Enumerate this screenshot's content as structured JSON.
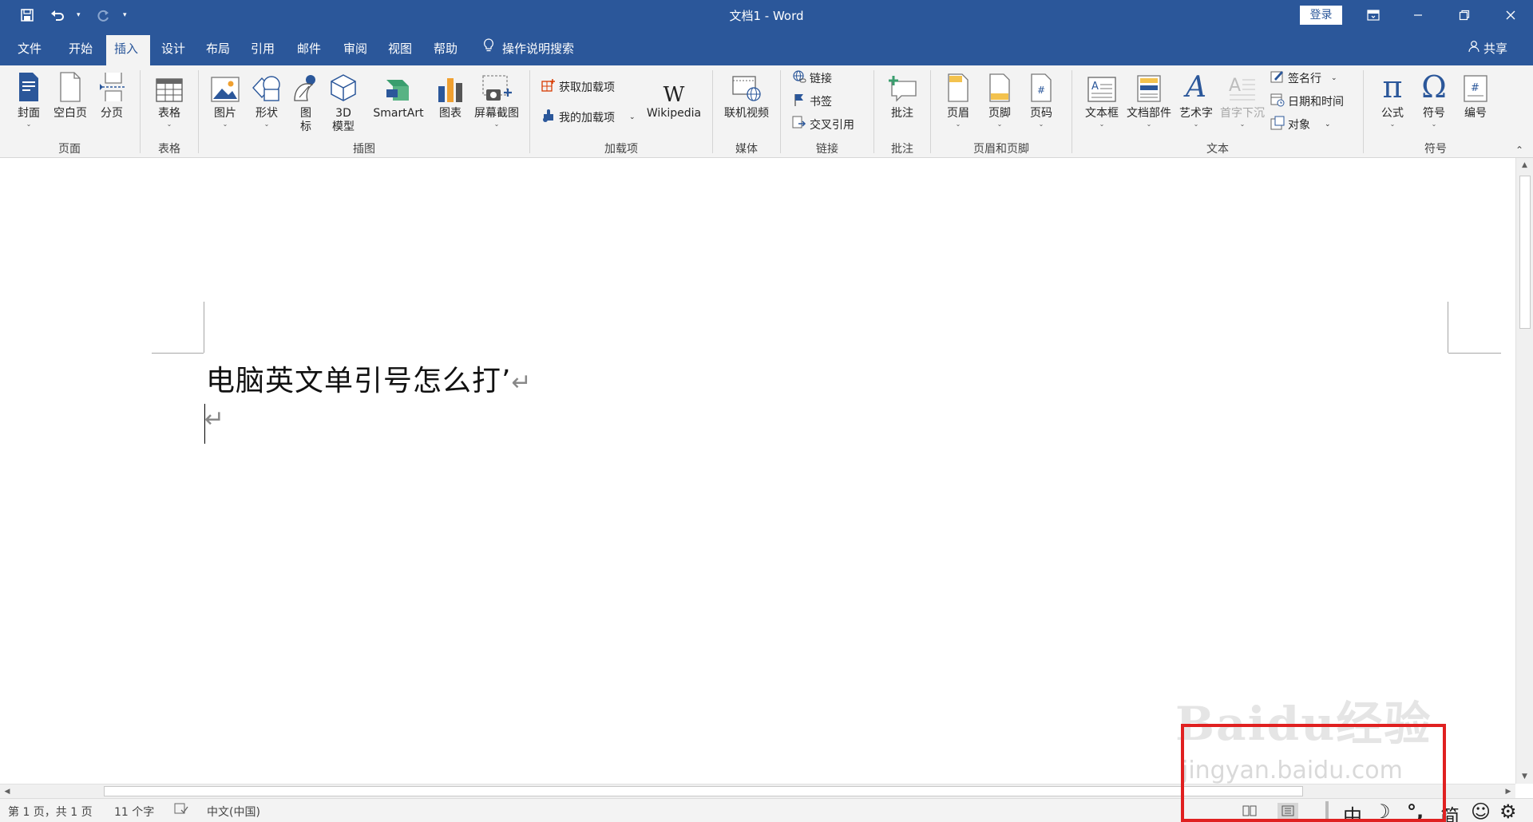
{
  "window": {
    "title": "文档1  -  Word",
    "login_label": "登录"
  },
  "menu": {
    "tabs": [
      "文件",
      "开始",
      "插入",
      "设计",
      "布局",
      "引用",
      "邮件",
      "审阅",
      "视图",
      "帮助"
    ],
    "active_tab": "插入",
    "tell_me": "操作说明搜索",
    "share": "共享"
  },
  "ribbon": {
    "groups": {
      "pages": {
        "label": "页面",
        "buttons": [
          "封面",
          "空白页",
          "分页"
        ]
      },
      "tables": {
        "label": "表格",
        "buttons": [
          "表格"
        ]
      },
      "illustrations": {
        "label": "插图",
        "buttons": [
          "图片",
          "形状",
          "图\n标",
          "3D\n模型",
          "SmartArt",
          "图表",
          "屏幕截图"
        ]
      },
      "addins": {
        "label": "加载项",
        "get": "获取加载项",
        "mine": "我的加载项",
        "wikipedia": "Wikipedia"
      },
      "media": {
        "label": "媒体",
        "buttons": [
          "联机视频"
        ]
      },
      "links": {
        "label": "链接",
        "items": [
          "链接",
          "书签",
          "交叉引用"
        ]
      },
      "comments": {
        "label": "批注",
        "buttons": [
          "批注"
        ]
      },
      "header_footer": {
        "label": "页眉和页脚",
        "buttons": [
          "页眉",
          "页脚",
          "页码"
        ]
      },
      "text": {
        "label": "文本",
        "buttons": [
          "文本框",
          "文档部件",
          "艺术字",
          "首字下沉"
        ],
        "small": [
          "签名行",
          "日期和时间",
          "对象"
        ]
      },
      "symbols": {
        "label": "符号",
        "buttons": [
          "公式",
          "符号",
          "编号"
        ]
      }
    }
  },
  "document": {
    "line1": "电脑英文单引号怎么打’",
    "para_mark": "↵"
  },
  "status": {
    "page": "第 1 页，共 1 页",
    "words": "11 个字",
    "language": "中文(中国)"
  },
  "ime": {
    "mode": "中",
    "punct": "°,",
    "script": "简"
  },
  "watermark": {
    "brand": "Baidu经验",
    "url": "jingyan.baidu.com"
  },
  "colors": {
    "accent": "#2b579a",
    "highlight": "#e02020"
  }
}
